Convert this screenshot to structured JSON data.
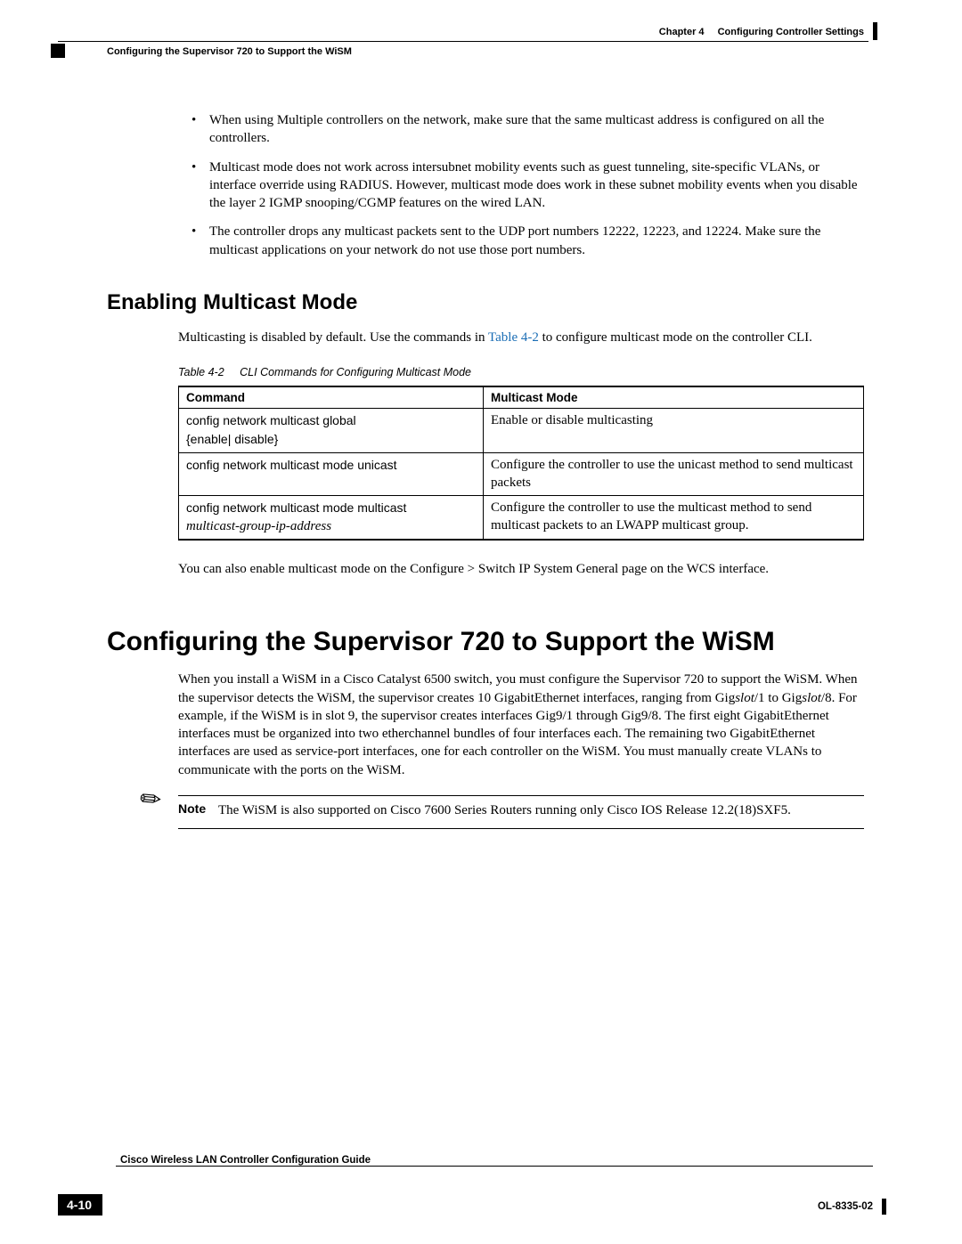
{
  "header": {
    "chapter": "Chapter 4",
    "chapter_title": "Configuring Controller Settings",
    "section_path": "Configuring the Supervisor 720 to Support the WiSM"
  },
  "bullets": [
    "When using Multiple controllers on the network, make sure that the same multicast address is configured on all the controllers.",
    "Multicast mode does not work across intersubnet mobility events such as guest tunneling, site-specific VLANs, or interface override using RADIUS. However, multicast mode does work in these subnet mobility events when you disable the layer 2 IGMP snooping/CGMP features on the wired LAN.",
    "The controller drops any multicast packets sent to the UDP port numbers 12222, 12223, and 12224. Make sure the multicast applications on your network do not use those port numbers."
  ],
  "h2": "Enabling Multicast Mode",
  "intro_pre": "Multicasting is disabled by default. Use the commands in ",
  "intro_link": "Table 4-2",
  "intro_post": " to configure multicast mode on the controller CLI.",
  "table": {
    "caption_num": "Table 4-2",
    "caption_text": "CLI Commands for Configuring Multicast Mode",
    "headers": {
      "c1": "Command",
      "c2": "Multicast Mode"
    },
    "rows": [
      {
        "cmd_sans": "config network multicast global",
        "cmd_extra_sans": "{enable| disable}",
        "cmd_ital": "",
        "desc": "Enable or disable multicasting"
      },
      {
        "cmd_sans": "config network multicast mode unicast",
        "cmd_extra_sans": "",
        "cmd_ital": "",
        "desc": "Configure the controller to use the unicast method to send multicast packets"
      },
      {
        "cmd_sans": "config network multicast mode multicast",
        "cmd_extra_sans": "",
        "cmd_ital": "multicast-group-ip-address",
        "desc": "Configure the controller to use the multicast method to send multicast packets to an LWAPP multicast group."
      }
    ]
  },
  "after_table": "You can also enable multicast mode on the Configure > Switch IP System General page on the WCS interface.",
  "h1": "Configuring the Supervisor 720 to Support the WiSM",
  "sup_para_pre": "When you install a WiSM in a Cisco Catalyst 6500 switch, you must configure the Supervisor 720 to support the WiSM. When the supervisor detects the WiSM, the supervisor creates 10 GigabitEthernet interfaces, ranging from Gig",
  "sup_slot1": "slot",
  "sup_mid1": "/1 to Gig",
  "sup_slot2": "slot",
  "sup_para_post": "/8. For example, if the WiSM is in slot 9, the supervisor creates interfaces Gig9/1 through Gig9/8. The first eight GigabitEthernet interfaces must be organized into two etherchannel bundles of four interfaces each. The remaining two GigabitEthernet interfaces are used as service-port interfaces, one for each controller on the WiSM. You must manually create VLANs to communicate with the ports on the WiSM.",
  "note": {
    "label": "Note",
    "text": "The WiSM is also supported on Cisco 7600 Series Routers running only Cisco IOS Release 12.2(18)SXF5."
  },
  "footer": {
    "guide": "Cisco Wireless LAN Controller Configuration Guide",
    "page": "4-10",
    "docnum": "OL-8335-02"
  }
}
